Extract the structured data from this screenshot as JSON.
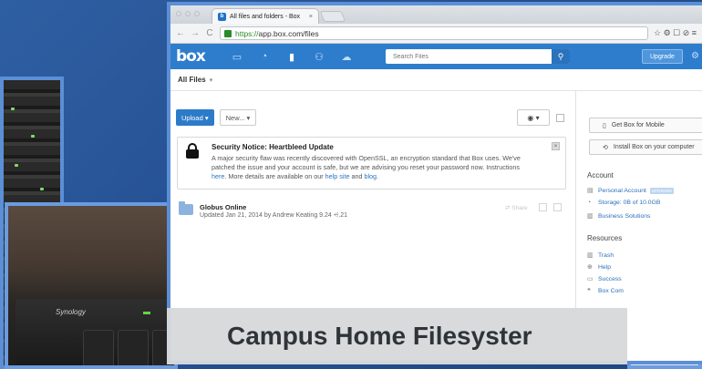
{
  "browser": {
    "tab_title": "All files and folders - Box",
    "tab_close": "×",
    "url_https": "https://",
    "url_rest": "app.box.com/files",
    "back": "←",
    "forward": "→",
    "reload": "C",
    "toolbar_icons": "☆ ⚙ ☐ ⊘ ≡"
  },
  "box": {
    "logo": "box",
    "nav_icons": [
      "▭",
      "◔",
      "▮",
      "⚇",
      "☁"
    ],
    "search_placeholder": "Search Files",
    "search_icon": "⚲",
    "upgrade_label": "Upgrade",
    "gear": "⚙"
  },
  "breadcrumb": {
    "label": "All Files",
    "caret": "▾"
  },
  "actions": {
    "upload_label": "Upload ▾",
    "new_label": "New... ▾",
    "view_label": "◉ ▾"
  },
  "notice": {
    "title": "Security Notice: Heartbleed Update",
    "line1": "A major security flaw was recently discovered with OpenSSL, an encryption standard that Box uses. We've",
    "line2": "patched the issue and your account is safe, but we are advising you reset your password now. Instructions",
    "here": "here",
    "line3": ". More details are available on our ",
    "help_link": "help site",
    "and": " and ",
    "blog_link": "blog",
    "period": ".",
    "close": "×"
  },
  "files": [
    {
      "name": "Globus Online",
      "meta": "Updated Jan 21, 2014 by Andrew Keating  9.24  ⩤.21",
      "share": "⇄  Share"
    }
  ],
  "sidebar": {
    "mobile_btn": "Get Box for Mobile",
    "computer_btn": "Install Box on your computer",
    "account_head": "Account",
    "account_links": [
      {
        "icon": "▤",
        "label": "Personal Account",
        "badge": "UPGRADE"
      },
      {
        "icon": "◔",
        "label": "Storage: 0B of 10.0GB"
      },
      {
        "icon": "▥",
        "label": "Business Solutions"
      }
    ],
    "resources_head": "Resources",
    "resource_links": [
      {
        "icon": "▥",
        "label": "Trash"
      },
      {
        "icon": "⊕",
        "label": "Help"
      },
      {
        "icon": "▭",
        "label": "Success"
      },
      {
        "icon": "❝",
        "label": "Box Com"
      }
    ]
  },
  "nas": {
    "brand": "Synology"
  },
  "caption": "Campus Home Filesyster"
}
